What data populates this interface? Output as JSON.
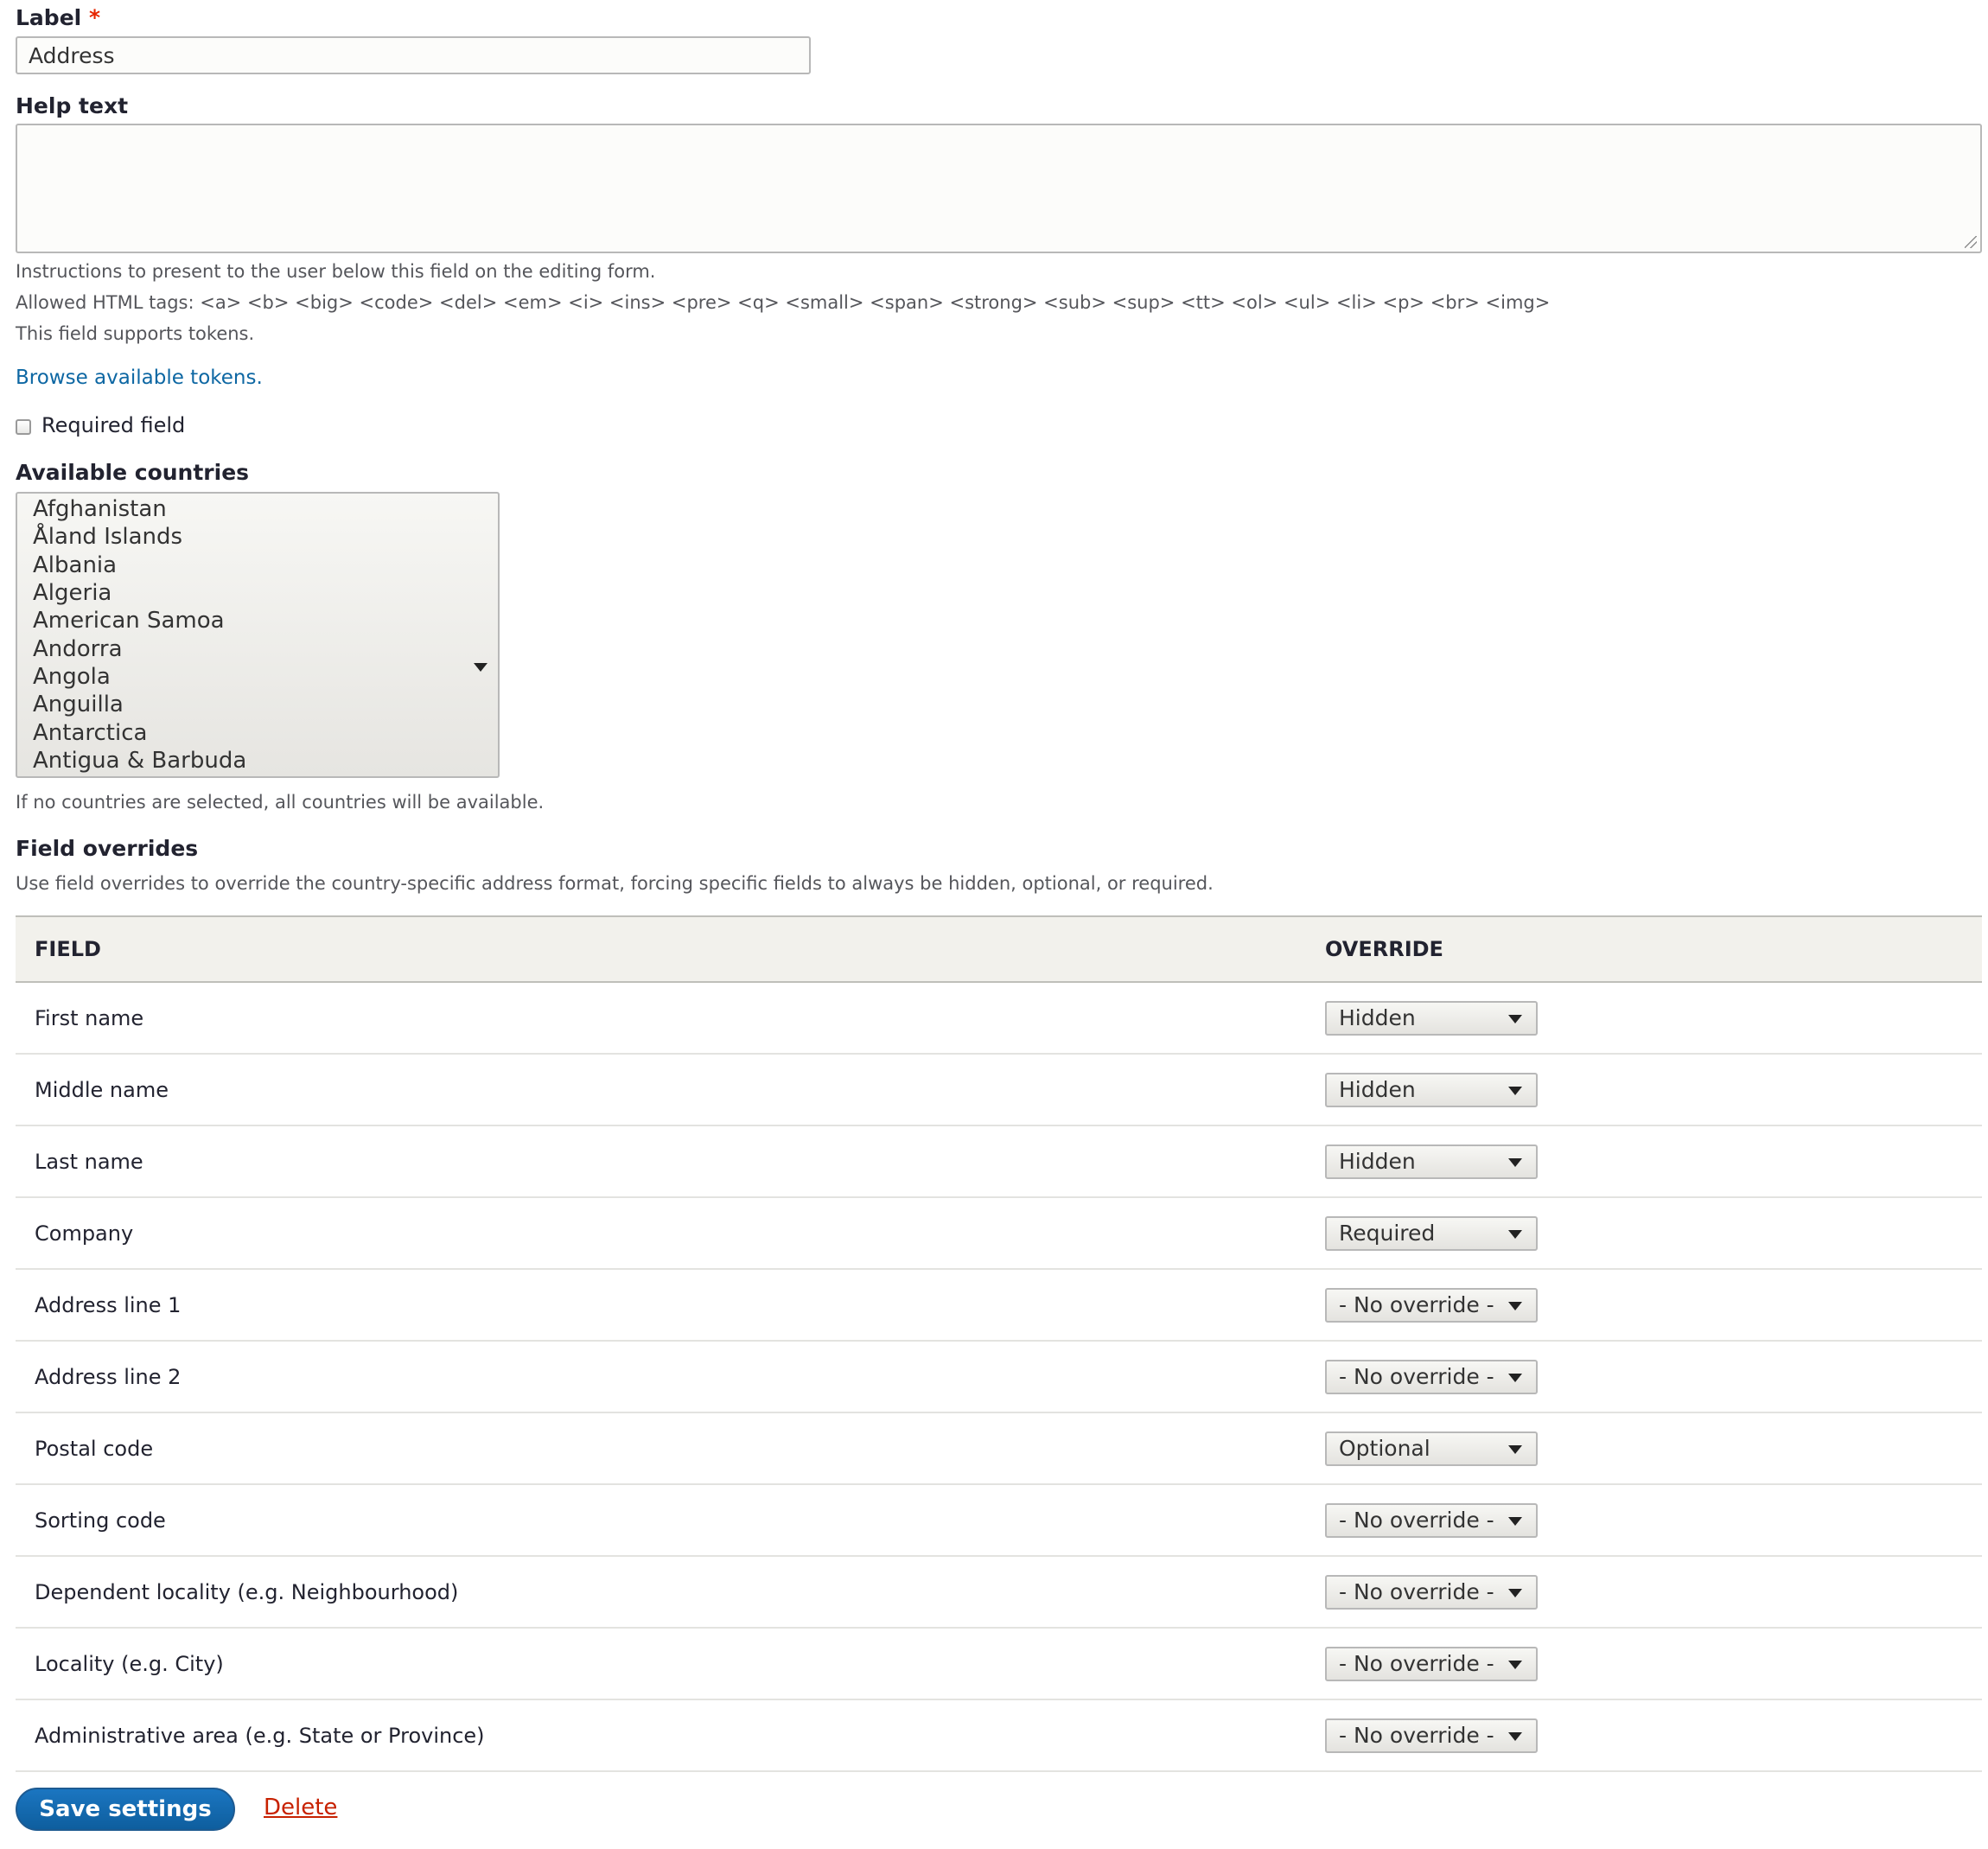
{
  "label_field": {
    "label": "Label",
    "required_marker": "*",
    "value": "Address"
  },
  "help_text": {
    "label": "Help text",
    "value": "",
    "descriptions": [
      "Instructions to present to the user below this field on the editing form.",
      "Allowed HTML tags: <a> <b> <big> <code> <del> <em> <i> <ins> <pre> <q> <small> <span> <strong> <sub> <sup> <tt> <ol> <ul> <li> <p> <br> <img>",
      "This field supports tokens."
    ],
    "tokens_link": "Browse available tokens."
  },
  "required_field": {
    "label": "Required field",
    "checked": false
  },
  "available_countries": {
    "label": "Available countries",
    "options": [
      "Afghanistan",
      "Åland Islands",
      "Albania",
      "Algeria",
      "American Samoa",
      "Andorra",
      "Angola",
      "Anguilla",
      "Antarctica",
      "Antigua & Barbuda"
    ],
    "description": "If no countries are selected, all countries will be available."
  },
  "field_overrides": {
    "heading": "Field overrides",
    "description": "Use field overrides to override the country-specific address format, forcing specific fields to always be hidden, optional, or required.",
    "columns": [
      "FIELD",
      "OVERRIDE"
    ],
    "rows": [
      {
        "field": "First name",
        "override": "Hidden"
      },
      {
        "field": "Middle name",
        "override": "Hidden"
      },
      {
        "field": "Last name",
        "override": "Hidden"
      },
      {
        "field": "Company",
        "override": "Required"
      },
      {
        "field": "Address line 1",
        "override": "- No override -"
      },
      {
        "field": "Address line 2",
        "override": "- No override -"
      },
      {
        "field": "Postal code",
        "override": "Optional"
      },
      {
        "field": "Sorting code",
        "override": "- No override -"
      },
      {
        "field": "Dependent locality (e.g. Neighbourhood)",
        "override": "- No override -"
      },
      {
        "field": "Locality (e.g. City)",
        "override": "- No override -"
      },
      {
        "field": "Administrative area (e.g. State or Province)",
        "override": "- No override -"
      }
    ]
  },
  "actions": {
    "save": "Save settings",
    "delete": "Delete"
  },
  "colors": {
    "primary": "#1b76c1",
    "link": "#0d67a3",
    "danger": "#c72100",
    "required_marker": "#e62600",
    "table_header_bg": "#f2f1ec"
  },
  "icons": {
    "select_caret": "chevron-down-icon",
    "resize_handle": "resize-grip-icon"
  }
}
